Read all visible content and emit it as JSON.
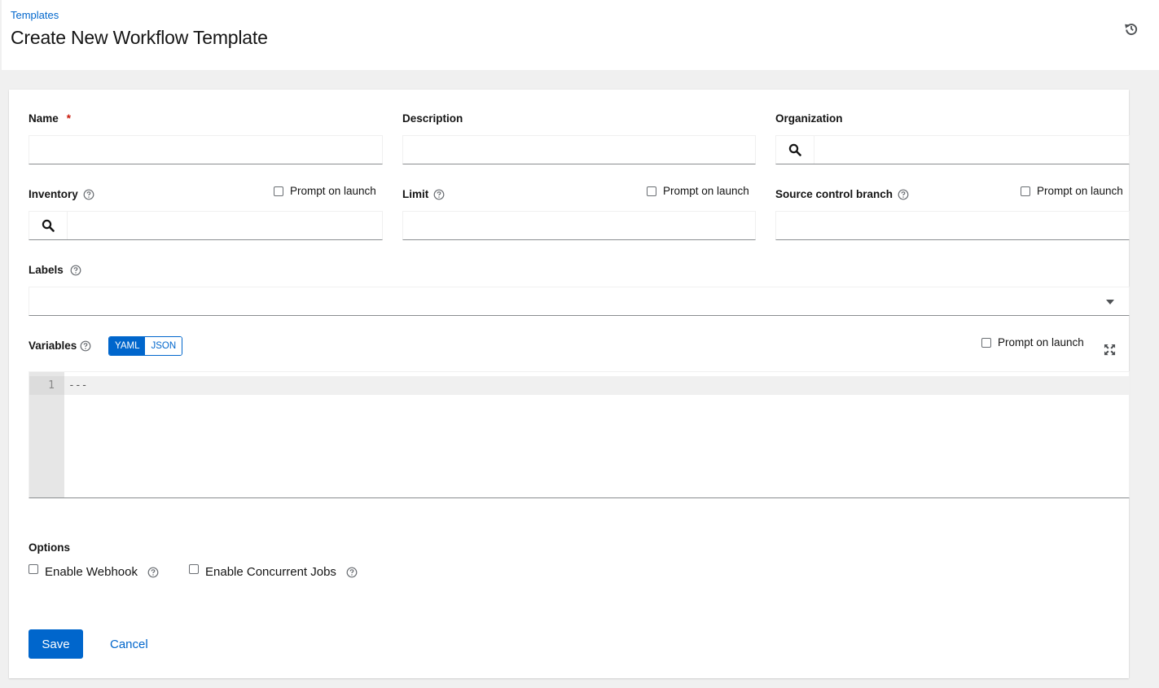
{
  "header": {
    "breadcrumb": "Templates",
    "title": "Create New Workflow Template",
    "history_icon": "history-icon"
  },
  "form": {
    "name": {
      "label": "Name",
      "required_marker": "*",
      "value": ""
    },
    "description": {
      "label": "Description",
      "value": ""
    },
    "organization": {
      "label": "Organization",
      "value": "",
      "icon": "search-icon"
    },
    "inventory": {
      "label": "Inventory",
      "value": "",
      "icon": "search-icon",
      "prompt_label": "Prompt on launch",
      "prompt_checked": false
    },
    "limit": {
      "label": "Limit",
      "value": "",
      "prompt_label": "Prompt on launch",
      "prompt_checked": false
    },
    "scm_branch": {
      "label": "Source control branch",
      "value": "",
      "prompt_label": "Prompt on launch",
      "prompt_checked": false
    },
    "labels": {
      "label": "Labels",
      "value": ""
    },
    "variables": {
      "label": "Variables",
      "modes": [
        "YAML",
        "JSON"
      ],
      "active_mode": "YAML",
      "prompt_label": "Prompt on launch",
      "prompt_checked": false,
      "lines": [
        {
          "number": "1",
          "text": "---"
        }
      ]
    },
    "options": {
      "label": "Options",
      "items": [
        {
          "label": "Enable Webhook",
          "checked": false
        },
        {
          "label": "Enable Concurrent Jobs",
          "checked": false
        }
      ]
    }
  },
  "actions": {
    "save_label": "Save",
    "cancel_label": "Cancel"
  },
  "colors": {
    "primary": "#0066cc",
    "required": "#c9190b",
    "page_bg": "#f0f0f0"
  }
}
